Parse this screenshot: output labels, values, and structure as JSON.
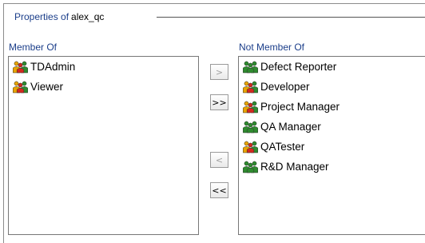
{
  "group": {
    "title_prefix": "Properties of",
    "user": "alex_qc"
  },
  "member_of": {
    "label": "Member Of",
    "items": [
      {
        "label": "TDAdmin",
        "icon": "admin-group-icon"
      },
      {
        "label": "Viewer",
        "icon": "admin-group-icon"
      }
    ]
  },
  "not_member_of": {
    "label": "Not Member Of",
    "items": [
      {
        "label": "Defect Reporter",
        "icon": "user-group-icon"
      },
      {
        "label": "Developer",
        "icon": "admin-group-icon"
      },
      {
        "label": "Project Manager",
        "icon": "admin-group-icon"
      },
      {
        "label": "QA Manager",
        "icon": "user-group-icon"
      },
      {
        "label": "QATester",
        "icon": "admin-group-icon"
      },
      {
        "label": "R&D Manager",
        "icon": "user-group-icon"
      }
    ]
  },
  "buttons": {
    "move_one_right": ">",
    "move_all_right": ">>",
    "move_one_left": "<",
    "move_all_left": "<<"
  },
  "colors": {
    "label_blue": "#1b3e8a",
    "group_green": "#2e8b2e",
    "group_orange": "#e8a400",
    "group_red": "#d42a1e"
  }
}
